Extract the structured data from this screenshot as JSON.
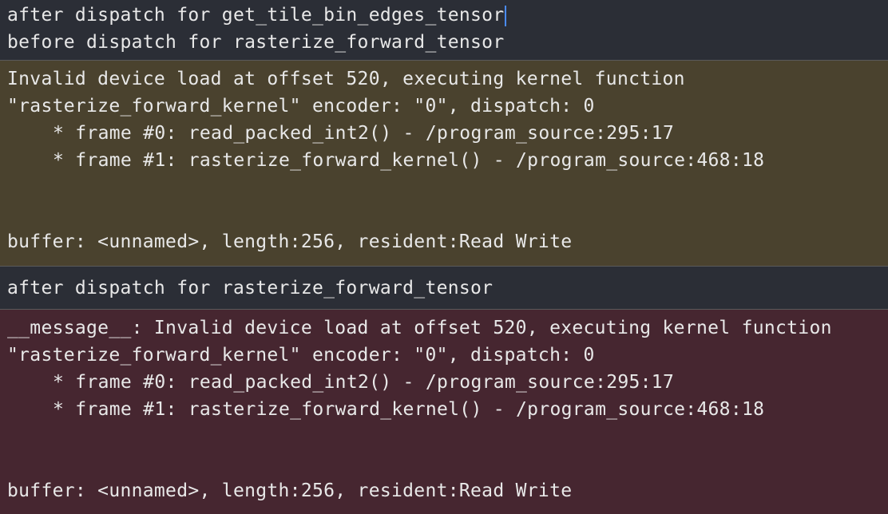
{
  "console": {
    "block1": {
      "lines": [
        "after dispatch for get_tile_bin_edges_tensor",
        "before dispatch for rasterize_forward_tensor"
      ]
    },
    "block2": {
      "lines": [
        "Invalid device load at offset 520, executing kernel function",
        "\"rasterize_forward_kernel\" encoder: \"0\", dispatch: 0",
        "* frame #0: read_packed_int2() - /program_source:295:17",
        "* frame #1: rasterize_forward_kernel() - /program_source:468:18",
        "buffer: <unnamed>, length:256, resident:Read Write"
      ]
    },
    "block3": {
      "lines": [
        "after dispatch for rasterize_forward_tensor"
      ]
    },
    "block4": {
      "lines": [
        "__message__: Invalid device load at offset 520, executing kernel function",
        "\"rasterize_forward_kernel\" encoder: \"0\", dispatch: 0",
        "* frame #0: read_packed_int2() - /program_source:295:17",
        "* frame #1: rasterize_forward_kernel() - /program_source:468:18",
        "buffer: <unnamed>, length:256, resident:Read Write"
      ]
    }
  },
  "colors": {
    "plain_bg": "#2b2e36",
    "warning_bg": "#4a422e",
    "error_bg": "#462630",
    "text": "#e8e8e8",
    "cursor": "#4a8cff"
  }
}
